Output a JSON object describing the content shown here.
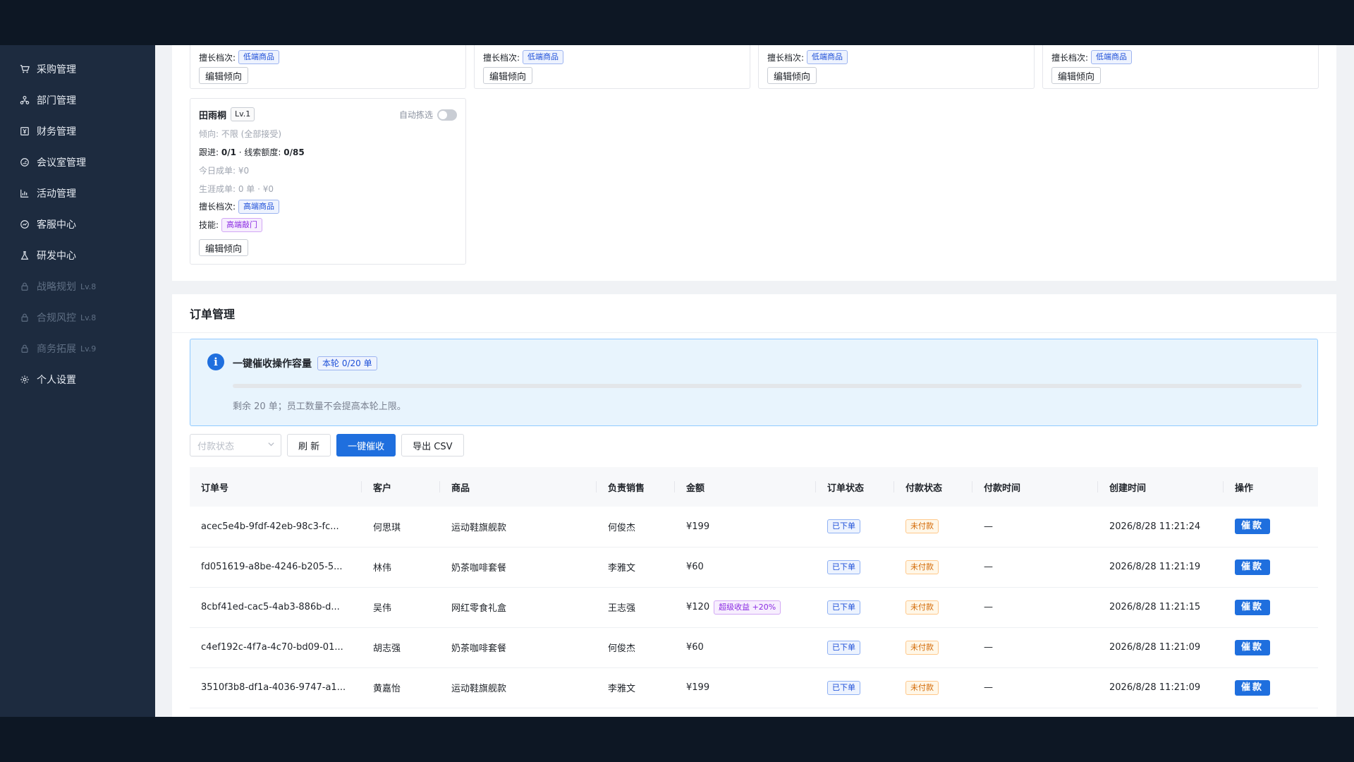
{
  "sidebar": {
    "items": [
      {
        "label": "采购管理",
        "locked": false
      },
      {
        "label": "部门管理",
        "locked": false
      },
      {
        "label": "财务管理",
        "locked": false
      },
      {
        "label": "会议室管理",
        "locked": false
      },
      {
        "label": "活动管理",
        "locked": false
      },
      {
        "label": "客服中心",
        "locked": false
      },
      {
        "label": "研发中心",
        "locked": false
      },
      {
        "label": "战略规划",
        "locked": true,
        "level": "Lv.8"
      },
      {
        "label": "合规风控",
        "locked": true,
        "level": "Lv.8"
      },
      {
        "label": "商务拓展",
        "locked": true,
        "level": "Lv.9"
      },
      {
        "label": "个人设置",
        "locked": false
      }
    ]
  },
  "top_cards": {
    "tier_label": "擅长档次:",
    "tier_value": "低端商品",
    "edit_label": "编辑倾向"
  },
  "employee_card": {
    "name": "田雨桐",
    "level": "Lv.1",
    "auto_pick_label": "自动拣选",
    "auto_pick_on": false,
    "preference": "倾向: 不限 (全部接受)",
    "follow_label": "跟进: ",
    "follow_value": "0/1",
    "quota_label": " · 线索额度: ",
    "quota_value": "0/85",
    "today": "今日成单: ¥0",
    "career": "生涯成单: 0 单 · ¥0",
    "tier_label": "擅长档次:",
    "tier_value": "高端商品",
    "skill_label": "技能:",
    "skill_value": "高端敲门",
    "edit_label": "编辑倾向"
  },
  "orders": {
    "title": "订单管理",
    "alert": {
      "title": "一键催收操作容量",
      "badge": "本轮 0/20 单",
      "progress_fraction": 0,
      "note": "剩余 20 单；员工数量不会提高本轮上限。"
    },
    "toolbar": {
      "filter_placeholder": "付款状态",
      "refresh": "刷 新",
      "urge_all": "一键催收",
      "export": "导出 CSV"
    },
    "columns": [
      "订单号",
      "客户",
      "商品",
      "负责销售",
      "金额",
      "订单状态",
      "付款状态",
      "付款时间",
      "创建时间",
      "操作"
    ],
    "rows": [
      {
        "id": "acec5e4b-9fdf-42eb-98c3-fc...",
        "customer": "何思琪",
        "product": "运动鞋旗舰款",
        "sales": "何俊杰",
        "amount": "¥199",
        "bonus": "",
        "order_status": "已下单",
        "pay_status": "未付款",
        "pay_time": "—",
        "created": "2026/8/28 11:21:24",
        "action": "催款"
      },
      {
        "id": "fd051619-a8be-4246-b205-5...",
        "customer": "林伟",
        "product": "奶茶咖啡套餐",
        "sales": "李雅文",
        "amount": "¥60",
        "bonus": "",
        "order_status": "已下单",
        "pay_status": "未付款",
        "pay_time": "—",
        "created": "2026/8/28 11:21:19",
        "action": "催款"
      },
      {
        "id": "8cbf41ed-cac5-4ab3-886b-d...",
        "customer": "吴伟",
        "product": "网红零食礼盒",
        "sales": "王志强",
        "amount": "¥120",
        "bonus": "超级收益 +20%",
        "order_status": "已下单",
        "pay_status": "未付款",
        "pay_time": "—",
        "created": "2026/8/28 11:21:15",
        "action": "催款"
      },
      {
        "id": "c4ef192c-4f7a-4c70-bd09-01...",
        "customer": "胡志强",
        "product": "奶茶咖啡套餐",
        "sales": "何俊杰",
        "amount": "¥60",
        "bonus": "",
        "order_status": "已下单",
        "pay_status": "未付款",
        "pay_time": "—",
        "created": "2026/8/28 11:21:09",
        "action": "催款"
      },
      {
        "id": "3510f3b8-df1a-4036-9747-a1...",
        "customer": "黄嘉怡",
        "product": "运动鞋旗舰款",
        "sales": "李雅文",
        "amount": "¥199",
        "bonus": "",
        "order_status": "已下单",
        "pay_status": "未付款",
        "pay_time": "—",
        "created": "2026/8/28 11:21:09",
        "action": "催款"
      }
    ]
  },
  "icons": [
    "cart-icon",
    "org-icon",
    "finance-icon",
    "meeting-icon",
    "chart-icon",
    "service-icon",
    "flask-icon",
    "lock-icon",
    "gear-icon",
    "info-icon",
    "chevron-down-icon"
  ]
}
